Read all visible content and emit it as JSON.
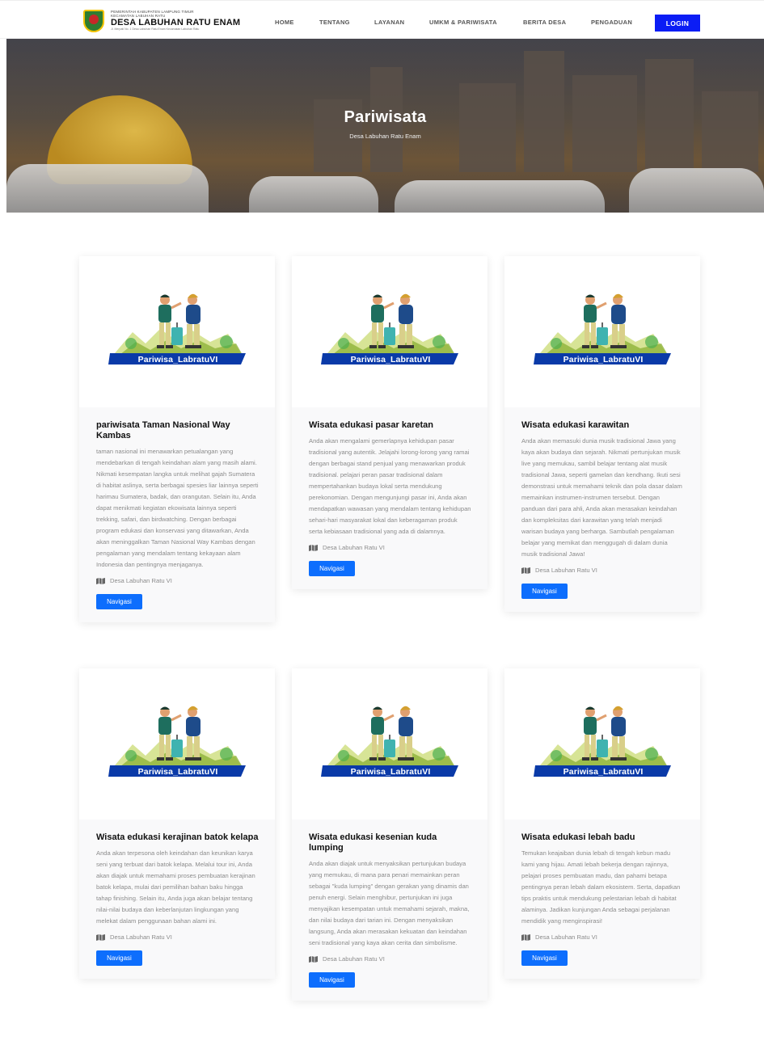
{
  "header": {
    "brand": {
      "line1": "PEMERINTAH KABUPATEN LAMPUNG TIMUR",
      "line2": "KECAMATAN LABUHAN RATU",
      "title": "DESA LABUHAN RATU ENAM",
      "address": "Jl. Merpati No. 1 Desa Labuhan Ratu Enam Kecamatan Labuhan Ratu"
    },
    "nav": [
      "HOME",
      "TENTANG",
      "LAYANAN",
      "UMKM & PARIWISATA",
      "BERITA DESA",
      "PENGADUAN"
    ],
    "login_label": "LOGIN"
  },
  "hero": {
    "title": "Pariwisata",
    "subtitle": "Desa Labuhan Ratu Enam"
  },
  "card_image_label": "Pariwisa_LabratuVI",
  "cards": [
    {
      "title": "pariwisata Taman Nasional Way Kambas",
      "text": "taman nasional ini menawarkan petualangan yang mendebarkan di tengah keindahan alam yang masih alami. Nikmati kesempatan langka untuk melihat gajah Sumatera di habitat aslinya, serta berbagai spesies liar lainnya seperti harimau Sumatera, badak, dan orangutan. Selain itu, Anda dapat menikmati kegiatan ekowisata lainnya seperti trekking, safari, dan birdwatching. Dengan berbagai program edukasi dan konservasi yang ditawarkan, Anda akan meninggalkan Taman Nasional Way Kambas dengan pengalaman yang mendalam tentang kekayaan alam Indonesia dan pentingnya menjaganya.",
      "location": "Desa Labuhan Ratu VI",
      "button": "Navigasi"
    },
    {
      "title": "Wisata edukasi pasar karetan",
      "text": "Anda akan mengalami gemerlapnya kehidupan pasar tradisional yang autentik. Jelajahi lorong-lorong yang ramai dengan berbagai stand penjual yang menawarkan produk tradisional. pelajari peran pasar tradisional dalam mempertahankan budaya lokal serta mendukung perekonomian. Dengan mengunjungi pasar ini, Anda akan mendapatkan wawasan yang mendalam tentang kehidupan sehari-hari masyarakat lokal dan keberagaman produk serta kebiasaan tradisional yang ada di dalamnya.",
      "location": "Desa Labuhan Ratu VI",
      "button": "Navigasi"
    },
    {
      "title": "Wisata edukasi karawitan",
      "text": "Anda akan memasuki dunia musik tradisional Jawa yang kaya akan budaya dan sejarah. Nikmati pertunjukan musik live yang memukau, sambil belajar tentang alat musik tradisional Jawa, seperti gamelan dan kendhang. Ikuti sesi demonstrasi untuk memahami teknik dan pola dasar dalam memainkan instrumen-instrumen tersebut. Dengan panduan dari para ahli, Anda akan merasakan keindahan dan kompleksitas dari karawitan yang telah menjadi warisan budaya yang berharga. Sambutlah pengalaman belajar yang memikat dan menggugah di dalam dunia musik tradisional Jawa!",
      "location": "Desa Labuhan Ratu VI",
      "button": "Navigasi"
    },
    {
      "title": "Wisata edukasi kerajinan batok kelapa",
      "text": "Anda akan terpesona oleh keindahan dan keunikan karya seni yang terbuat dari batok kelapa. Melalui tour ini, Anda akan diajak untuk memahami proses pembuatan kerajinan batok kelapa, mulai dari pemilihan bahan baku hingga tahap finishing. Selain itu, Anda juga akan belajar tentang nilai-nilai budaya dan keberlanjutan lingkungan yang melekat dalam penggunaan bahan alami ini.",
      "location": "Desa Labuhan Ratu VI",
      "button": "Navigasi"
    },
    {
      "title": "Wisata edukasi kesenian kuda lumping",
      "text": "Anda akan diajak untuk menyaksikan pertunjukan budaya yang memukau, di mana para penari memainkan peran sebagai \"kuda lumping\" dengan gerakan yang dinamis dan penuh energi. Selain menghibur, pertunjukan ini juga menyajikan kesempatan untuk memahami sejarah, makna, dan nilai budaya dari tarian ini. Dengan menyaksikan langsung, Anda akan merasakan kekuatan dan keindahan seni tradisional yang kaya akan cerita dan simbolisme.",
      "location": "Desa Labuhan Ratu VI",
      "button": "Navigasi"
    },
    {
      "title": "Wisata edukasi lebah badu",
      "text": "Temukan keajaiban dunia lebah di tengah kebun madu kami yang hijau. Amati lebah bekerja dengan rajinnya, pelajari proses pembuatan madu, dan pahami betapa pentingnya peran lebah dalam ekosistem. Serta, dapatkan tips praktis untuk mendukung pelestarian lebah di habitat alaminya. Jadikan kunjungan Anda sebagai perjalanan mendidik yang menginspirasi!",
      "location": "Desa Labuhan Ratu VI",
      "button": "Navigasi"
    }
  ],
  "colors": {
    "login_button": "#0b1df5",
    "navigasi_button": "#0d6efd",
    "banner_blue": "#0a3aa8"
  }
}
